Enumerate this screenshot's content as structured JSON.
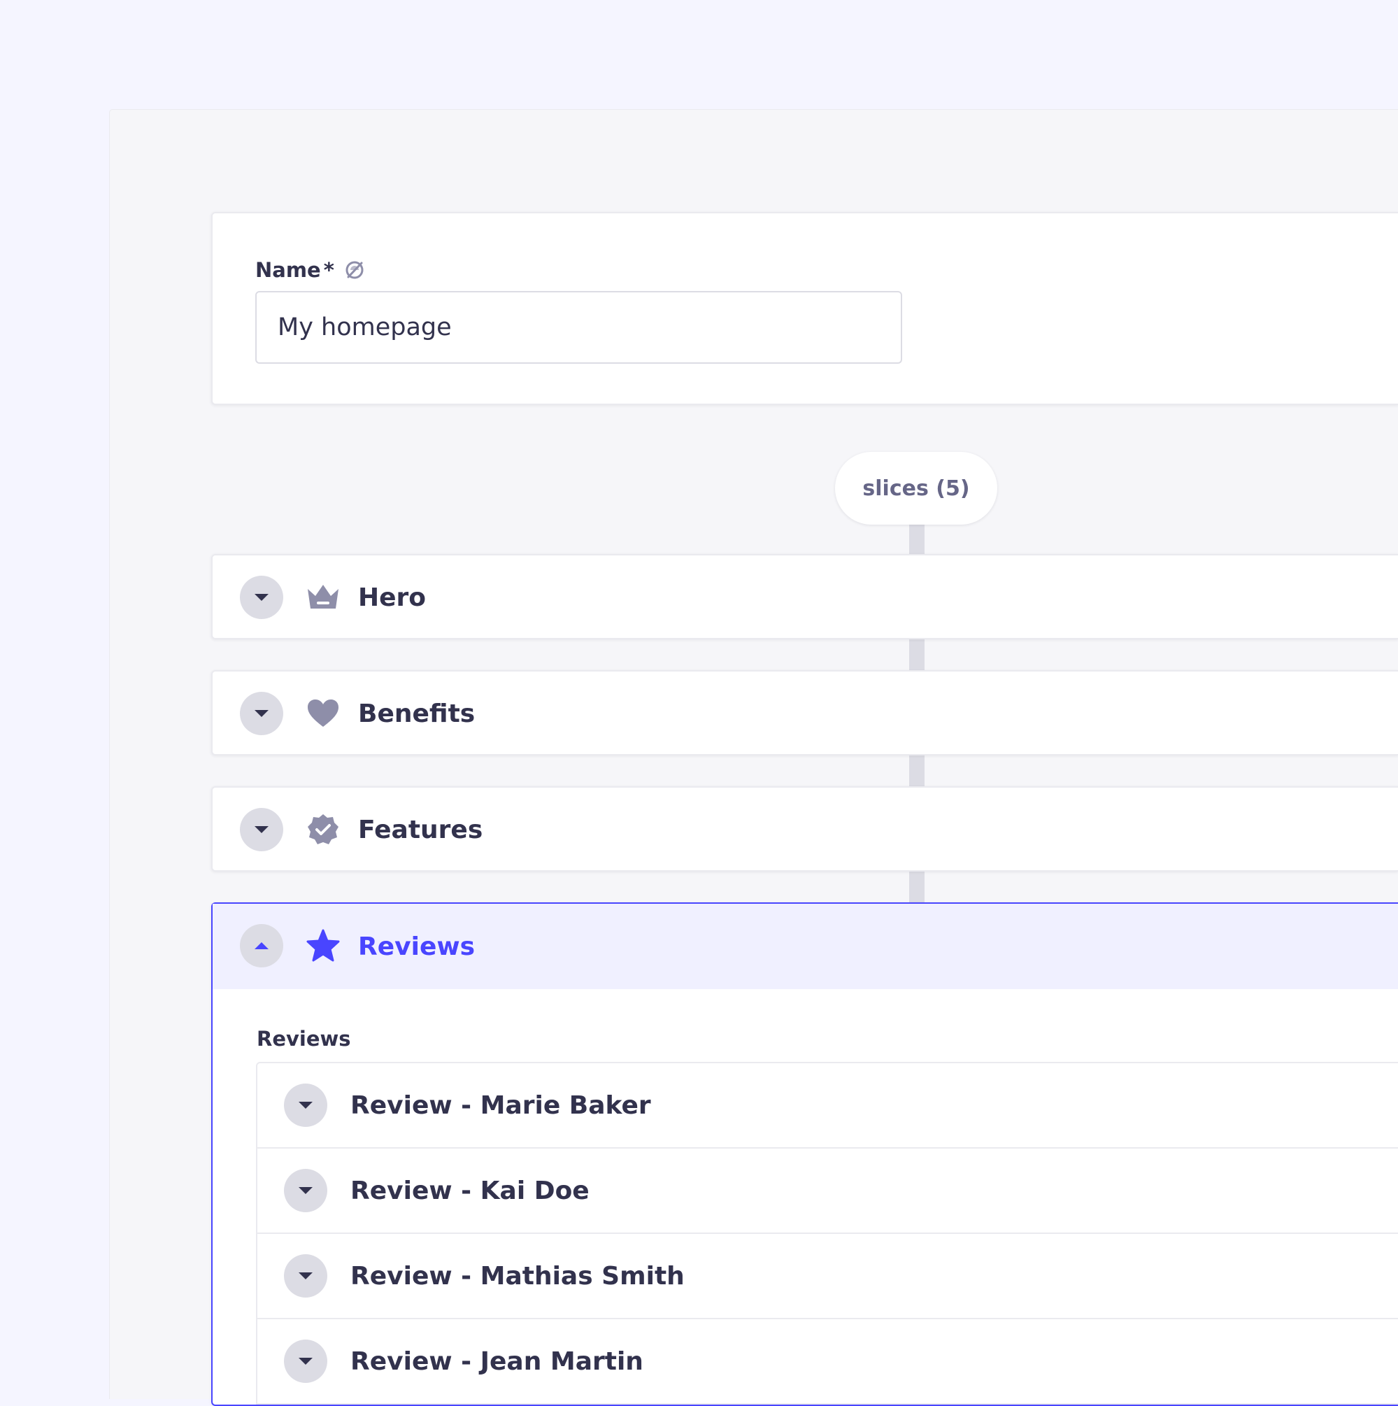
{
  "form": {
    "name_label": "Name",
    "required_mark": "*",
    "name_value": "My homepage"
  },
  "slices": {
    "pill_label": "slices (5)",
    "items": [
      {
        "title": "Hero",
        "icon": "crown-icon"
      },
      {
        "title": "Benefits",
        "icon": "heart-icon"
      },
      {
        "title": "Features",
        "icon": "verified-badge-icon"
      },
      {
        "title": "Reviews",
        "icon": "star-icon",
        "expanded": true
      }
    ]
  },
  "reviews": {
    "label": "Reviews",
    "items": [
      {
        "title": "Review - Marie Baker"
      },
      {
        "title": "Review - Kai Doe"
      },
      {
        "title": "Review - Mathias Smith"
      },
      {
        "title": "Review - Jean Martin"
      }
    ]
  },
  "colors": {
    "accent": "#4945ff",
    "accent_bg": "#f0f0ff",
    "text": "#32324d",
    "icon_gray": "#8e8ea9",
    "toggle_bg": "#dcdce4"
  }
}
